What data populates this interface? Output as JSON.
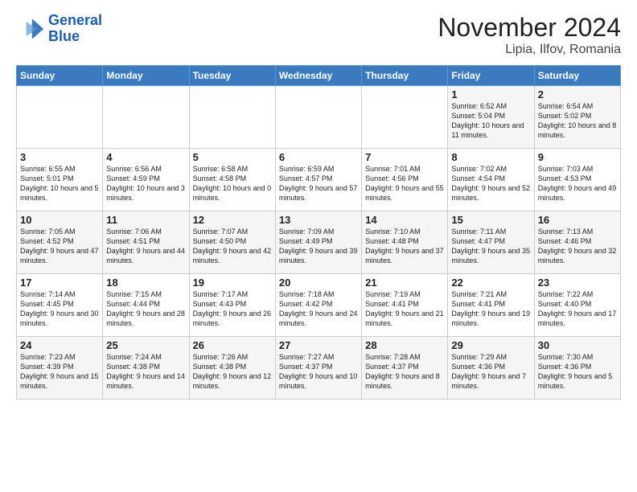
{
  "logo": {
    "line1": "General",
    "line2": "Blue"
  },
  "title": "November 2024",
  "location": "Lipia, Ilfov, Romania",
  "weekdays": [
    "Sunday",
    "Monday",
    "Tuesday",
    "Wednesday",
    "Thursday",
    "Friday",
    "Saturday"
  ],
  "weeks": [
    [
      {
        "day": "",
        "info": ""
      },
      {
        "day": "",
        "info": ""
      },
      {
        "day": "",
        "info": ""
      },
      {
        "day": "",
        "info": ""
      },
      {
        "day": "",
        "info": ""
      },
      {
        "day": "1",
        "info": "Sunrise: 6:52 AM\nSunset: 5:04 PM\nDaylight: 10 hours and 11 minutes."
      },
      {
        "day": "2",
        "info": "Sunrise: 6:54 AM\nSunset: 5:02 PM\nDaylight: 10 hours and 8 minutes."
      }
    ],
    [
      {
        "day": "3",
        "info": "Sunrise: 6:55 AM\nSunset: 5:01 PM\nDaylight: 10 hours and 5 minutes."
      },
      {
        "day": "4",
        "info": "Sunrise: 6:56 AM\nSunset: 4:59 PM\nDaylight: 10 hours and 3 minutes."
      },
      {
        "day": "5",
        "info": "Sunrise: 6:58 AM\nSunset: 4:58 PM\nDaylight: 10 hours and 0 minutes."
      },
      {
        "day": "6",
        "info": "Sunrise: 6:59 AM\nSunset: 4:57 PM\nDaylight: 9 hours and 57 minutes."
      },
      {
        "day": "7",
        "info": "Sunrise: 7:01 AM\nSunset: 4:56 PM\nDaylight: 9 hours and 55 minutes."
      },
      {
        "day": "8",
        "info": "Sunrise: 7:02 AM\nSunset: 4:54 PM\nDaylight: 9 hours and 52 minutes."
      },
      {
        "day": "9",
        "info": "Sunrise: 7:03 AM\nSunset: 4:53 PM\nDaylight: 9 hours and 49 minutes."
      }
    ],
    [
      {
        "day": "10",
        "info": "Sunrise: 7:05 AM\nSunset: 4:52 PM\nDaylight: 9 hours and 47 minutes."
      },
      {
        "day": "11",
        "info": "Sunrise: 7:06 AM\nSunset: 4:51 PM\nDaylight: 9 hours and 44 minutes."
      },
      {
        "day": "12",
        "info": "Sunrise: 7:07 AM\nSunset: 4:50 PM\nDaylight: 9 hours and 42 minutes."
      },
      {
        "day": "13",
        "info": "Sunrise: 7:09 AM\nSunset: 4:49 PM\nDaylight: 9 hours and 39 minutes."
      },
      {
        "day": "14",
        "info": "Sunrise: 7:10 AM\nSunset: 4:48 PM\nDaylight: 9 hours and 37 minutes."
      },
      {
        "day": "15",
        "info": "Sunrise: 7:11 AM\nSunset: 4:47 PM\nDaylight: 9 hours and 35 minutes."
      },
      {
        "day": "16",
        "info": "Sunrise: 7:13 AM\nSunset: 4:46 PM\nDaylight: 9 hours and 32 minutes."
      }
    ],
    [
      {
        "day": "17",
        "info": "Sunrise: 7:14 AM\nSunset: 4:45 PM\nDaylight: 9 hours and 30 minutes."
      },
      {
        "day": "18",
        "info": "Sunrise: 7:15 AM\nSunset: 4:44 PM\nDaylight: 9 hours and 28 minutes."
      },
      {
        "day": "19",
        "info": "Sunrise: 7:17 AM\nSunset: 4:43 PM\nDaylight: 9 hours and 26 minutes."
      },
      {
        "day": "20",
        "info": "Sunrise: 7:18 AM\nSunset: 4:42 PM\nDaylight: 9 hours and 24 minutes."
      },
      {
        "day": "21",
        "info": "Sunrise: 7:19 AM\nSunset: 4:41 PM\nDaylight: 9 hours and 21 minutes."
      },
      {
        "day": "22",
        "info": "Sunrise: 7:21 AM\nSunset: 4:41 PM\nDaylight: 9 hours and 19 minutes."
      },
      {
        "day": "23",
        "info": "Sunrise: 7:22 AM\nSunset: 4:40 PM\nDaylight: 9 hours and 17 minutes."
      }
    ],
    [
      {
        "day": "24",
        "info": "Sunrise: 7:23 AM\nSunset: 4:39 PM\nDaylight: 9 hours and 15 minutes."
      },
      {
        "day": "25",
        "info": "Sunrise: 7:24 AM\nSunset: 4:38 PM\nDaylight: 9 hours and 14 minutes."
      },
      {
        "day": "26",
        "info": "Sunrise: 7:26 AM\nSunset: 4:38 PM\nDaylight: 9 hours and 12 minutes."
      },
      {
        "day": "27",
        "info": "Sunrise: 7:27 AM\nSunset: 4:37 PM\nDaylight: 9 hours and 10 minutes."
      },
      {
        "day": "28",
        "info": "Sunrise: 7:28 AM\nSunset: 4:37 PM\nDaylight: 9 hours and 8 minutes."
      },
      {
        "day": "29",
        "info": "Sunrise: 7:29 AM\nSunset: 4:36 PM\nDaylight: 9 hours and 7 minutes."
      },
      {
        "day": "30",
        "info": "Sunrise: 7:30 AM\nSunset: 4:36 PM\nDaylight: 9 hours and 5 minutes."
      }
    ]
  ]
}
